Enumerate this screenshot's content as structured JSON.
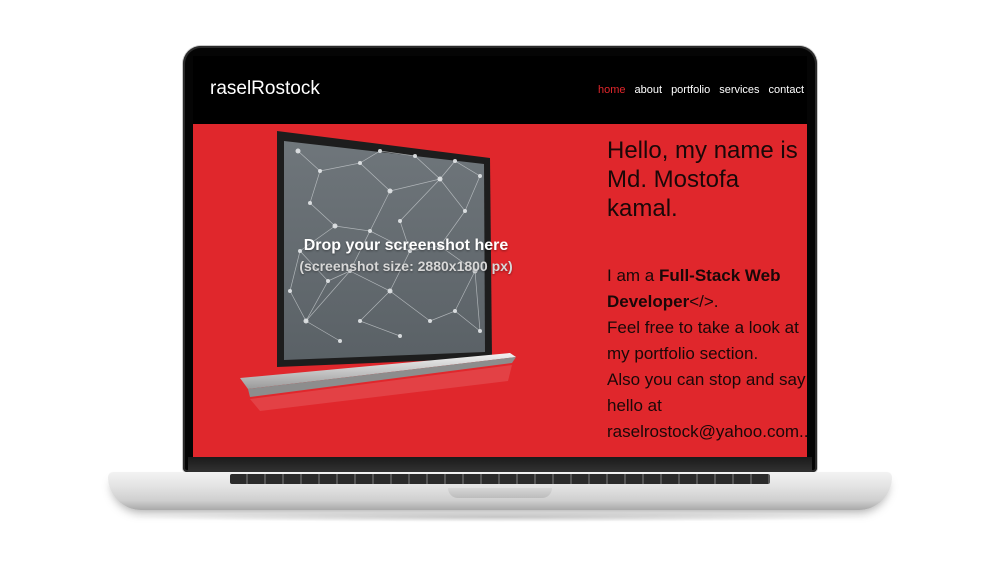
{
  "site": {
    "logo": "raselRostock",
    "nav": [
      "home",
      "about",
      "portfolio",
      "services",
      "contact"
    ],
    "active_nav": "home",
    "accent": "#e1262b"
  },
  "hero": {
    "greeting_line1": "Hello, my name is",
    "greeting_line2": "Md. Mostofa kamal.",
    "bio_prefix": "I am a ",
    "bio_bold": "Full-Stack Web Developer",
    "bio_code": "</>.",
    "bio_line2": "Feel free to take a look at my portfolio section.",
    "bio_line3": "Also you can stop and say hello at raselrostock@yahoo.com..",
    "placeholder_title": "Drop your screenshot here",
    "placeholder_sub": "(screenshot size: 2880x1800 px)"
  },
  "colors": {
    "hero_bg": "#e0272c",
    "header_bg": "#000000"
  }
}
